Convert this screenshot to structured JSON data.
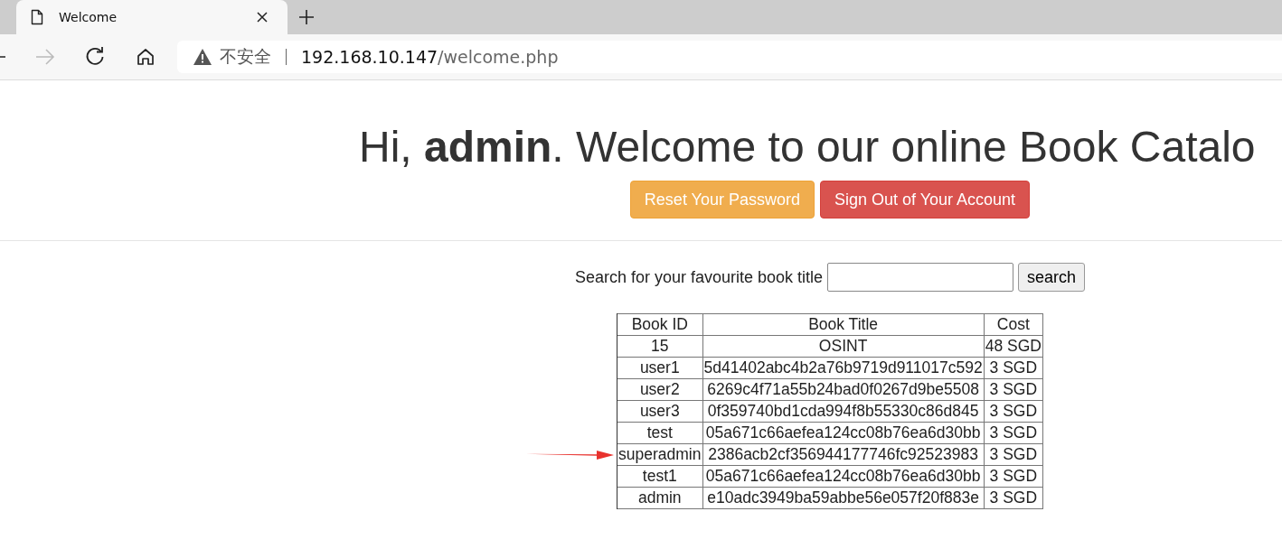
{
  "browser": {
    "tab": {
      "title": "Welcome",
      "selected": true
    },
    "forward_disabled": true,
    "address": {
      "security": "不安全",
      "host": "192.168.10.147",
      "path": "/welcome.php"
    }
  },
  "heading": "Hi, **admin**. Welcome to our online Book Catalo",
  "buttons": [
    {
      "label": "Reset Your Password",
      "kind": "warning"
    },
    {
      "label": "Sign Out of Your Account",
      "kind": "danger"
    }
  ],
  "search": {
    "label": "Search for your favourite book title",
    "button": "search"
  },
  "table": {
    "columns": [
      "Book ID",
      "Book Title",
      "Cost"
    ],
    "rows": [
      {
        "cells": [
          "15",
          "OSINT",
          "48 SGD"
        ],
        "arrow": false
      },
      {
        "cells": [
          "user1",
          "5d41402abc4b2a76b9719d911017c592",
          "3 SGD"
        ],
        "arrow": false
      },
      {
        "cells": [
          "user2",
          "6269c4f71a55b24bad0f0267d9be5508",
          "3 SGD"
        ],
        "arrow": false
      },
      {
        "cells": [
          "user3",
          "0f359740bd1cda994f8b55330c86d845",
          "3 SGD"
        ],
        "arrow": false
      },
      {
        "cells": [
          "test",
          "05a671c66aefea124cc08b76ea6d30bb",
          "3 SGD"
        ],
        "arrow": false
      },
      {
        "cells": [
          "superadmin",
          "2386acb2cf356944177746fc92523983",
          "3 SGD"
        ],
        "arrow": true
      },
      {
        "cells": [
          "test1",
          "05a671c66aefea124cc08b76ea6d30bb",
          "3 SGD"
        ],
        "arrow": false
      },
      {
        "cells": [
          "admin",
          "e10adc3949ba59abbe56e057f20f883e",
          "3 SGD"
        ],
        "arrow": false
      }
    ]
  }
}
